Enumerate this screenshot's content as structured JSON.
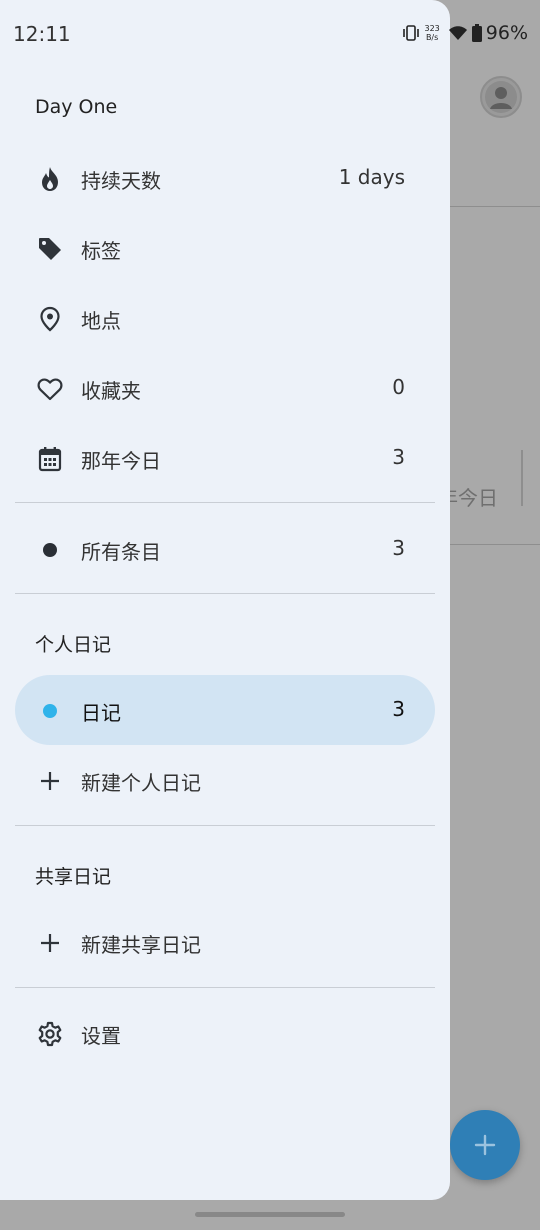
{
  "status": {
    "time": "12:11",
    "net_speed_value": "323",
    "net_speed_unit": "B/s",
    "battery": "96%"
  },
  "drawer": {
    "title": "Day One",
    "items": [
      {
        "label": "持续天数",
        "count": "1 days",
        "icon": "flame-icon"
      },
      {
        "label": "标签",
        "count": "",
        "icon": "tag-icon"
      },
      {
        "label": "地点",
        "count": "",
        "icon": "location-pin-icon"
      },
      {
        "label": "收藏夹",
        "count": "0",
        "icon": "heart-icon"
      },
      {
        "label": "那年今日",
        "count": "3",
        "icon": "calendar-icon"
      }
    ],
    "all_entries": {
      "label": "所有条目",
      "count": "3"
    },
    "personal_section": "个人日记",
    "journal": {
      "label": "日记",
      "count": "3"
    },
    "new_personal": "新建个人日记",
    "shared_section": "共享日记",
    "new_shared": "新建共享日记",
    "settings": "设置"
  },
  "background": {
    "tab_text": "年今日"
  },
  "colors": {
    "drawer_bg": "#edf2f9",
    "active_item_bg": "#d2e4f3",
    "journal_dot": "#2fb3ea",
    "fab": "#2f7fb6"
  }
}
